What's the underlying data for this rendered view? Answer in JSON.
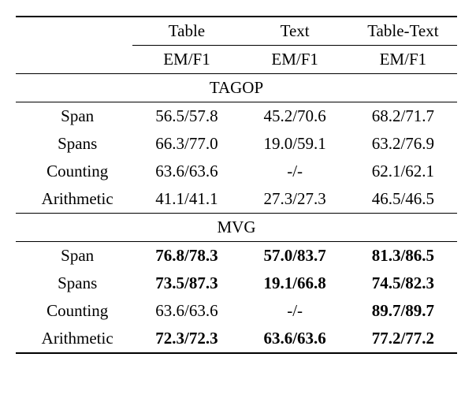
{
  "chart_data": {
    "type": "table",
    "title": "",
    "columns": [
      "Table EM/F1",
      "Text EM/F1",
      "Table-Text EM/F1"
    ],
    "sections": [
      {
        "name": "TAGOP",
        "rows": [
          {
            "label": "Span",
            "values": [
              "56.5/57.8",
              "45.2/70.6",
              "68.2/71.7"
            ],
            "bold": [
              false,
              false,
              false
            ]
          },
          {
            "label": "Spans",
            "values": [
              "66.3/77.0",
              "19.0/59.1",
              "63.2/76.9"
            ],
            "bold": [
              false,
              false,
              false
            ]
          },
          {
            "label": "Counting",
            "values": [
              "63.6/63.6",
              "-/-",
              "62.1/62.1"
            ],
            "bold": [
              false,
              false,
              false
            ]
          },
          {
            "label": "Arithmetic",
            "values": [
              "41.1/41.1",
              "27.3/27.3",
              "46.5/46.5"
            ],
            "bold": [
              false,
              false,
              false
            ]
          }
        ]
      },
      {
        "name": "MVG",
        "rows": [
          {
            "label": "Span",
            "values": [
              "76.8/78.3",
              "57.0/83.7",
              "81.3/86.5"
            ],
            "bold": [
              true,
              true,
              true
            ]
          },
          {
            "label": "Spans",
            "values": [
              "73.5/87.3",
              "19.1/66.8",
              "74.5/82.3"
            ],
            "bold": [
              true,
              true,
              true
            ]
          },
          {
            "label": "Counting",
            "values": [
              "63.6/63.6",
              "-/-",
              "89.7/89.7"
            ],
            "bold": [
              false,
              false,
              true
            ]
          },
          {
            "label": "Arithmetic",
            "values": [
              "72.3/72.3",
              "63.6/63.6",
              "77.2/77.2"
            ],
            "bold": [
              true,
              true,
              true
            ]
          }
        ]
      }
    ]
  },
  "headers": {
    "col1": "Table",
    "col2": "Text",
    "col3": "Table-Text",
    "sub": "EM/F1"
  },
  "sections": {
    "s0": {
      "name": "TAGOP",
      "rows": {
        "r0": {
          "label": "Span",
          "c0": "56.5/57.8",
          "c1": "45.2/70.6",
          "c2": "68.2/71.7"
        },
        "r1": {
          "label": "Spans",
          "c0": "66.3/77.0",
          "c1": "19.0/59.1",
          "c2": "63.2/76.9"
        },
        "r2": {
          "label": "Counting",
          "c0": "63.6/63.6",
          "c1": "-/-",
          "c2": "62.1/62.1"
        },
        "r3": {
          "label": "Arithmetic",
          "c0": "41.1/41.1",
          "c1": "27.3/27.3",
          "c2": "46.5/46.5"
        }
      }
    },
    "s1": {
      "name": "MVG",
      "rows": {
        "r0": {
          "label": "Span",
          "c0": "76.8/78.3",
          "c1": "57.0/83.7",
          "c2": "81.3/86.5"
        },
        "r1": {
          "label": "Spans",
          "c0": "73.5/87.3",
          "c1": "19.1/66.8",
          "c2": "74.5/82.3"
        },
        "r2": {
          "label": "Counting",
          "c0": "63.6/63.6",
          "c1": "-/-",
          "c2": "89.7/89.7"
        },
        "r3": {
          "label": "Arithmetic",
          "c0": "72.3/72.3",
          "c1": "63.6/63.6",
          "c2": "77.2/77.2"
        }
      }
    }
  }
}
